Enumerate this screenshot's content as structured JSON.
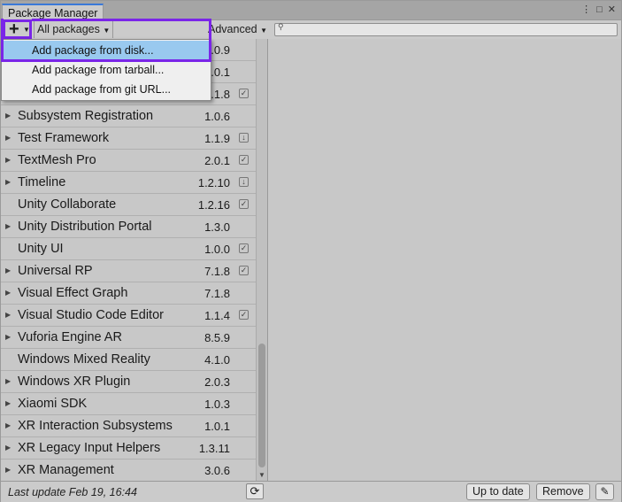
{
  "window": {
    "title": "Package Manager",
    "icons": [
      "more-icon",
      "maximize-icon",
      "close-icon"
    ]
  },
  "toolbar": {
    "add_glyph": "+",
    "filter_label": "All packages",
    "advanced_label": "Advanced",
    "search_placeholder": ""
  },
  "menu": {
    "items": [
      {
        "label": "Add package from disk..."
      },
      {
        "label": "Add package from tarball..."
      },
      {
        "label": "Add package from git URL..."
      }
    ]
  },
  "packages": [
    {
      "name": "",
      "version": "1.0.9",
      "status": ""
    },
    {
      "name": "",
      "version": "1.0.1",
      "status": ""
    },
    {
      "name": "",
      "version": "7.1.8",
      "status": "check"
    },
    {
      "name": "Subsystem Registration",
      "version": "1.0.6",
      "status": "",
      "arrow": true
    },
    {
      "name": "Test Framework",
      "version": "1.1.9",
      "status": "download",
      "arrow": true
    },
    {
      "name": "TextMesh Pro",
      "version": "2.0.1",
      "status": "check",
      "arrow": true
    },
    {
      "name": "Timeline",
      "version": "1.2.10",
      "status": "download",
      "arrow": true
    },
    {
      "name": "Unity Collaborate",
      "version": "1.2.16",
      "status": "check",
      "arrow": false
    },
    {
      "name": "Unity Distribution Portal",
      "version": "1.3.0",
      "status": "",
      "arrow": true
    },
    {
      "name": "Unity UI",
      "version": "1.0.0",
      "status": "check",
      "arrow": false
    },
    {
      "name": "Universal RP",
      "version": "7.1.8",
      "status": "check",
      "arrow": true
    },
    {
      "name": "Visual Effect Graph",
      "version": "7.1.8",
      "status": "",
      "arrow": true
    },
    {
      "name": "Visual Studio Code Editor",
      "version": "1.1.4",
      "status": "check",
      "arrow": true
    },
    {
      "name": "Vuforia Engine AR",
      "version": "8.5.9",
      "status": "",
      "arrow": true
    },
    {
      "name": "Windows Mixed Reality",
      "version": "4.1.0",
      "status": "",
      "arrow": false
    },
    {
      "name": "Windows XR Plugin",
      "version": "2.0.3",
      "status": "",
      "arrow": true
    },
    {
      "name": "Xiaomi SDK",
      "version": "1.0.3",
      "status": "",
      "arrow": true
    },
    {
      "name": "XR Interaction Subsystems",
      "version": "1.0.1",
      "status": "",
      "arrow": true
    },
    {
      "name": "XR Legacy Input Helpers",
      "version": "1.3.11",
      "status": "",
      "arrow": true
    },
    {
      "name": "XR Management",
      "version": "3.0.6",
      "status": "",
      "arrow": true
    }
  ],
  "status": {
    "last_update": "Last update Feb 19, 16:44",
    "up_to_date_label": "Up to date",
    "remove_label": "Remove"
  }
}
